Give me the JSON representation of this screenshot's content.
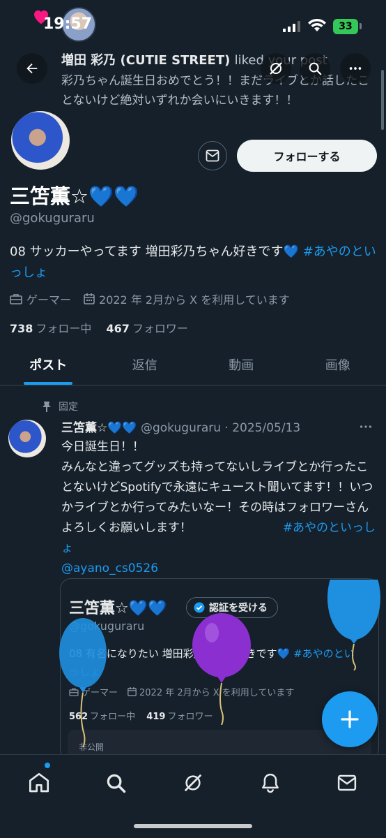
{
  "status_bar": {
    "time": "19:57",
    "battery": "33"
  },
  "notification": {
    "user": "増田 彩乃 (CUTIE STREET)",
    "action": "liked your post",
    "text": "彩乃ちゃん誕生日おめでとう！！まだライブとか話したことないけど絶対いずれか会いにいきます！！"
  },
  "profile": {
    "name": "三笘薫☆💙💙",
    "handle": "@gokuguraru",
    "follow_label": "フォローする",
    "bio": "08 サッカーやってます 増田彩乃ちゃん好きです💙",
    "bio_tag": "#あやのといっしょ",
    "category": "ゲーマー",
    "joined": "2022 年 2月から X を利用しています",
    "following_count": "738",
    "following_label": "フォロー中",
    "followers_count": "467",
    "followers_label": "フォロワー"
  },
  "tabs": [
    {
      "label": "ポスト",
      "active": true
    },
    {
      "label": "返信"
    },
    {
      "label": "動画"
    },
    {
      "label": "画像"
    }
  ],
  "post": {
    "pinned_label": "固定",
    "name": "三笘薫☆💙💙",
    "meta": "@gokuguraru · 2025/05/13",
    "text": "今日誕生日！！\nみんなと違ってグッズも持ってないしライブとか行ったことないけどSpotifyで永遠にキュースト聞いてます！！いつかライブとか行ってみたいなー！その時はフォロワーさんよろしくお願いします！",
    "hashtag": "#あやのといっしょ",
    "mention": "@ayano_cs0526"
  },
  "quote": {
    "name": "三笘薫☆💙💙",
    "verify_label": "認証を受ける",
    "handle": "@gokuguraru",
    "bio": "08 有名になりたい 増田彩乃ちゃん好きです💙",
    "bio_tag": "#あやのといっしょ",
    "category": "ゲーマー",
    "joined": "2022 年 2月から X を利用しています",
    "following_count": "562",
    "following_label": "フォロー中",
    "followers_count": "419",
    "followers_label": "フォロワー",
    "private_label": "非公開"
  },
  "colors": {
    "accent": "#1d9bf0",
    "background": "#15202b",
    "heart": "#f91880",
    "balloon_purple": "#8b2fd0"
  },
  "icons": [
    "back-arrow-icon",
    "grok-icon",
    "search-icon",
    "more-icon",
    "mail-icon",
    "briefcase-icon",
    "calendar-icon",
    "pin-icon",
    "verified-icon",
    "compose-plus-icon",
    "home-icon",
    "notifications-icon"
  ]
}
